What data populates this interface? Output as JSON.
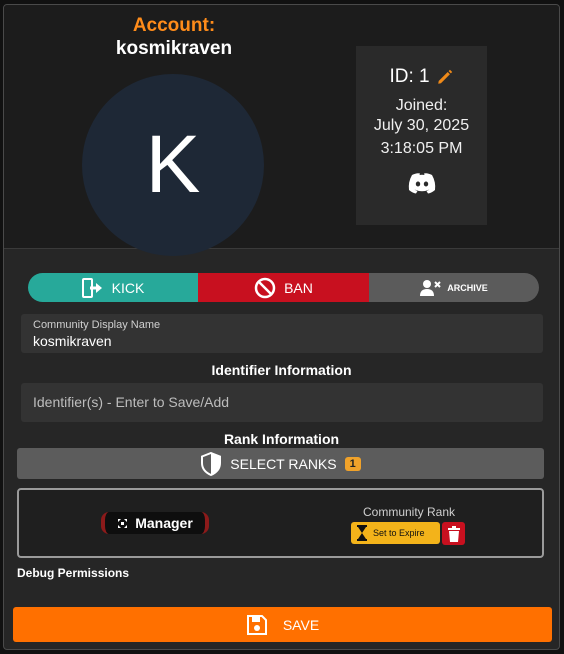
{
  "header": {
    "account_label": "Account:",
    "username": "kosmikraven",
    "avatar_letter": "K"
  },
  "info": {
    "id_text": "ID: 1",
    "joined_label": "Joined:",
    "joined_date": "July 30, 2025",
    "joined_time": "3:18:05 PM",
    "discord_icon": "discord-icon"
  },
  "actions": {
    "kick": "KICK",
    "ban": "BAN",
    "archive": "ARCHIVE"
  },
  "display_name": {
    "label": "Community Display Name",
    "value": "kosmikraven"
  },
  "identifiers": {
    "title": "Identifier Information",
    "placeholder": "Identifier(s) - Enter to Save/Add"
  },
  "ranks": {
    "title": "Rank Information",
    "select_label": "SELECT RANKS",
    "count": "1",
    "rank_name": "Manager",
    "community_rank_label": "Community Rank",
    "expire_label": "Set to Expire"
  },
  "debug_label": "Debug Permissions",
  "save_label": "SAVE",
  "colors": {
    "accent_orange": "#ff7000",
    "kick_teal": "#27a99a",
    "ban_red": "#c8101f",
    "archive_gray": "#5b5b5b",
    "expire_yellow": "#f3b31a"
  }
}
